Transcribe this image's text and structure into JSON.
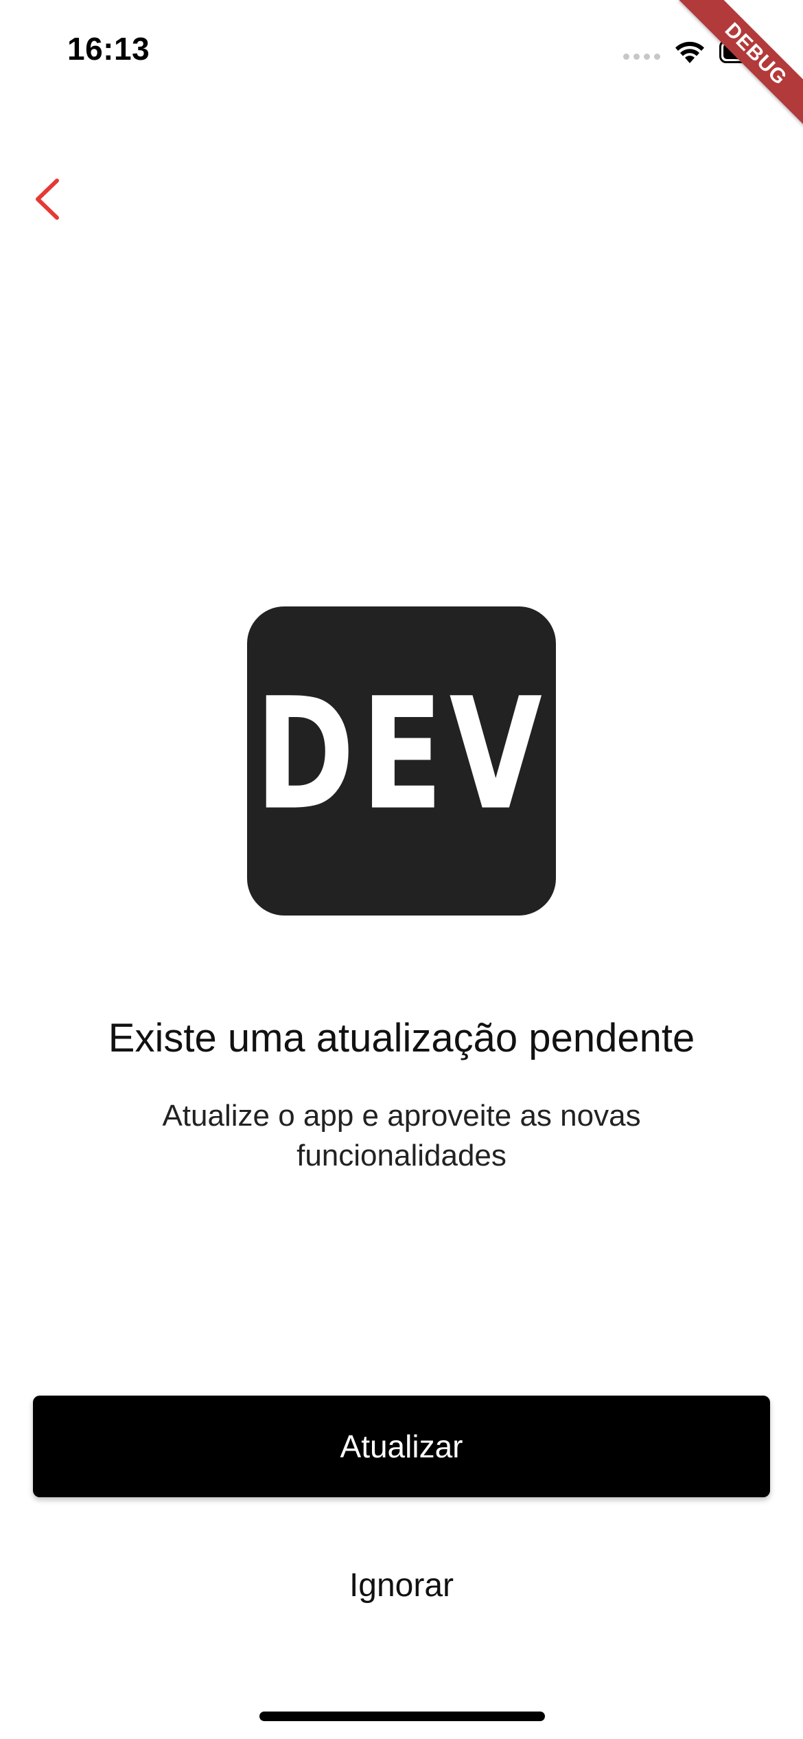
{
  "status_bar": {
    "time": "16:13",
    "icons": [
      "cellular-signal-icon",
      "wifi-icon",
      "battery-icon"
    ]
  },
  "debug_banner": {
    "label": "DEBUG",
    "color": "#b33a3a"
  },
  "navigation": {
    "back_icon": "chevron-left-icon",
    "accent_color": "#e53935"
  },
  "logo": {
    "text": "DEV",
    "background_color": "#222222"
  },
  "content": {
    "title": "Existe uma atualização pendente",
    "subtitle": "Atualize o app e aproveite as novas funcionalidades"
  },
  "actions": {
    "update_label": "Atualizar",
    "ignore_label": "Ignorar"
  }
}
